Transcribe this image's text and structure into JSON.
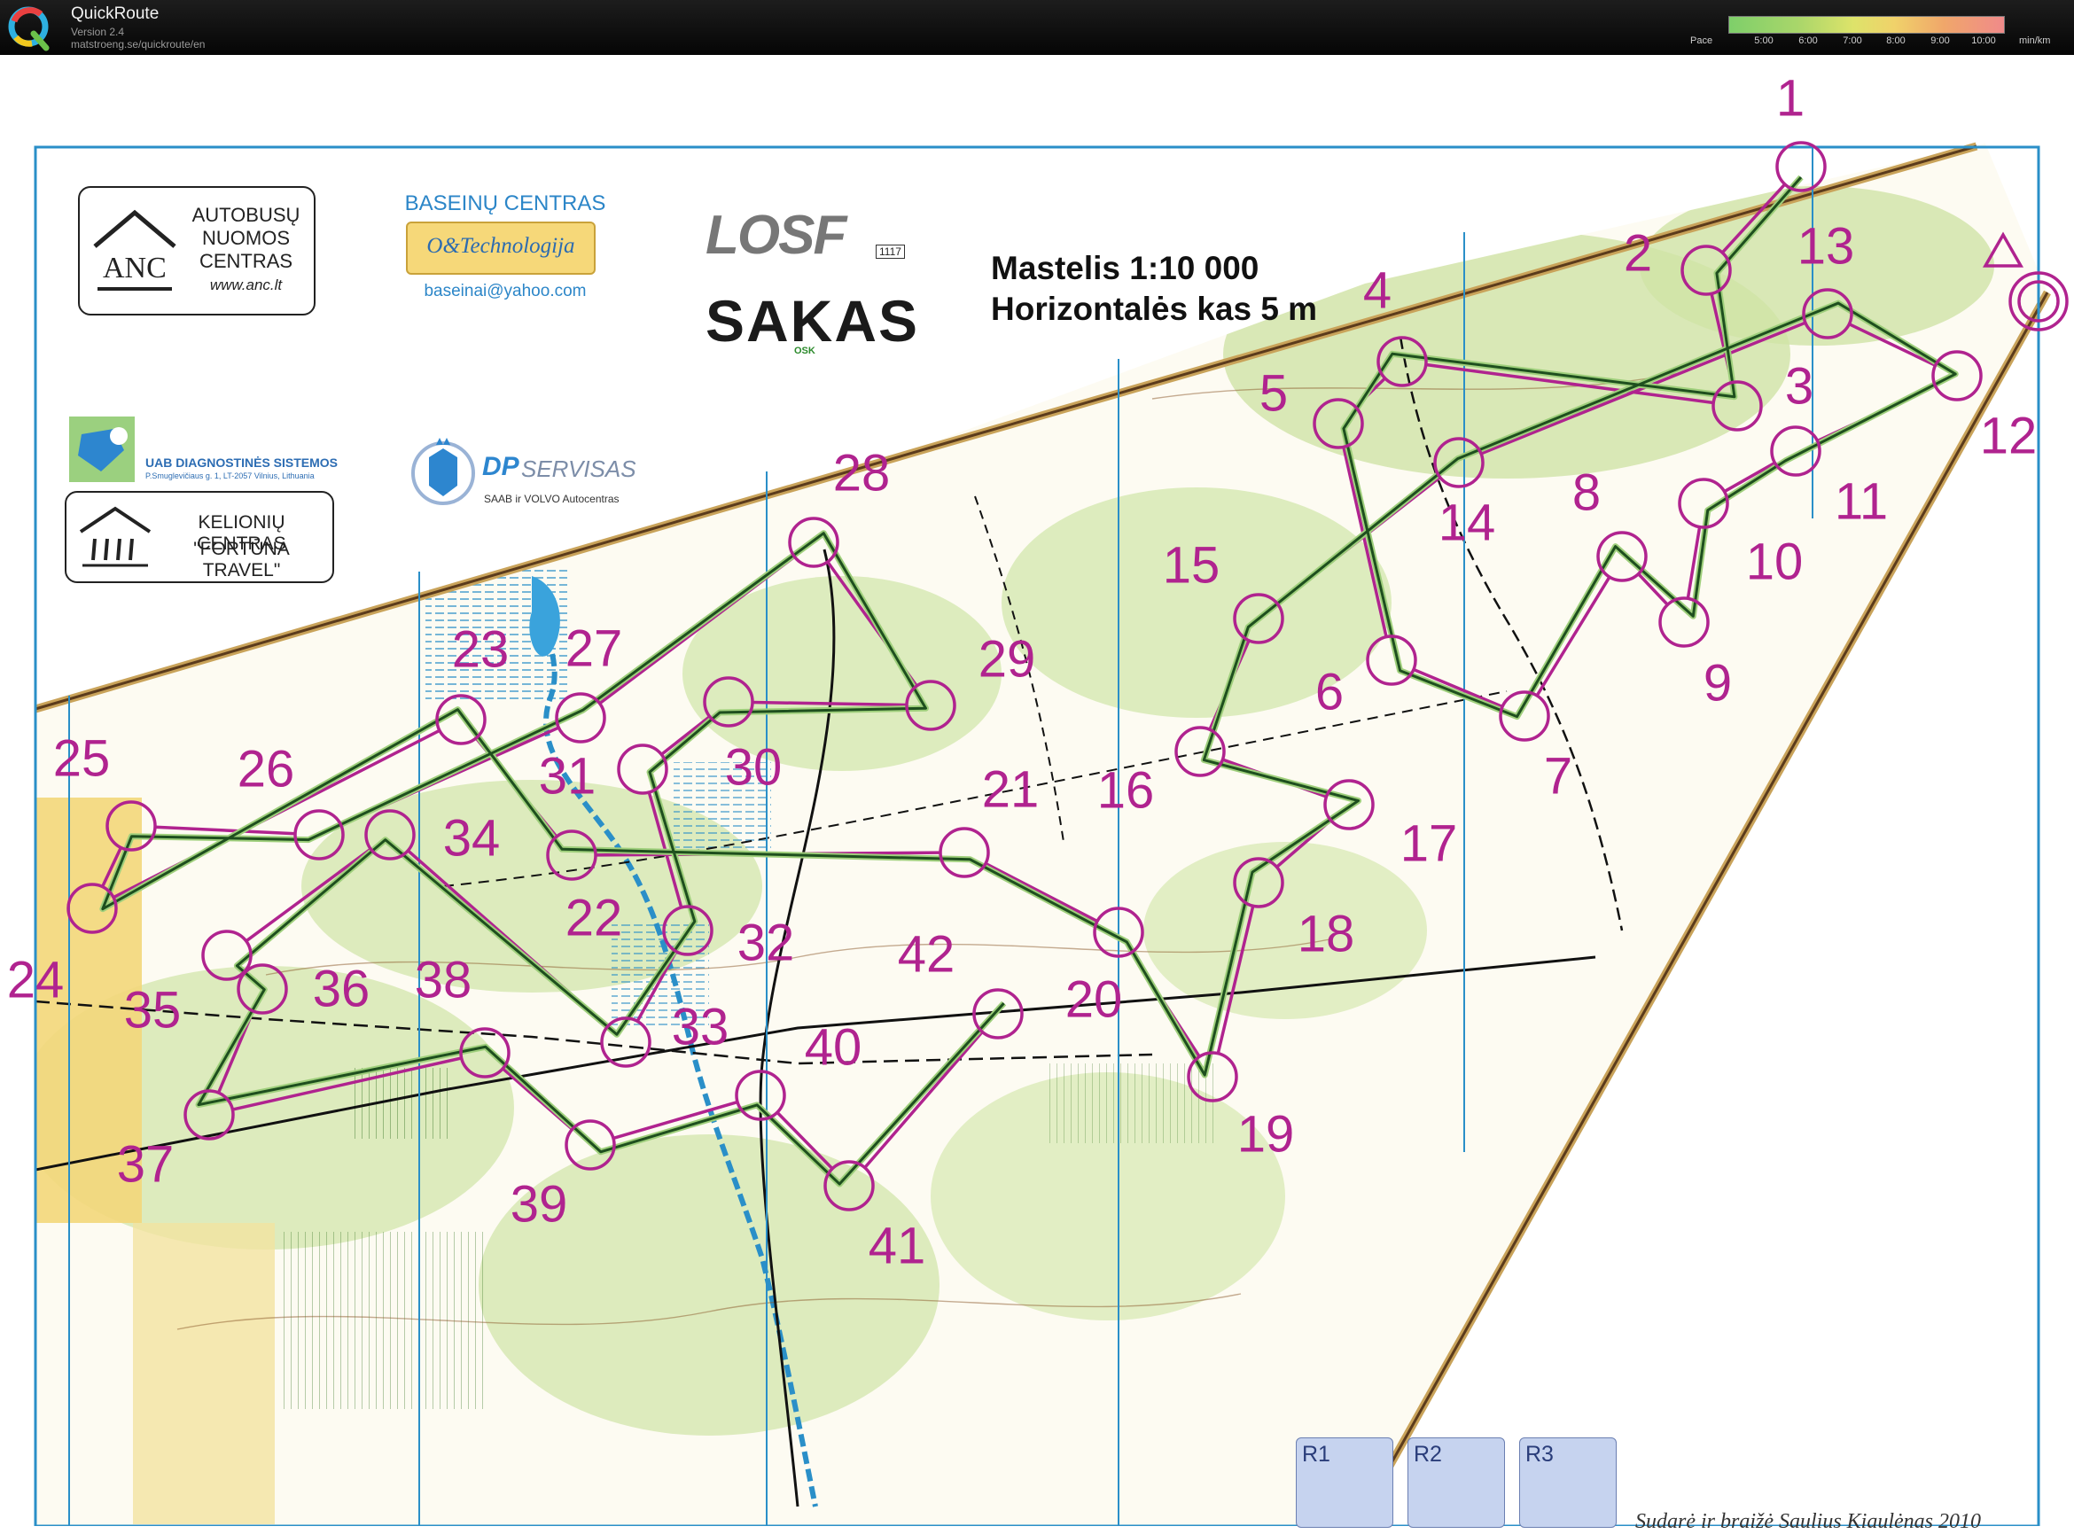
{
  "app": {
    "title": "QuickRoute",
    "version": "Version 2.4",
    "url": "matstroeng.se/quickroute/en"
  },
  "pace_legend": {
    "label": "Pace",
    "ticks": [
      "5:00",
      "6:00",
      "7:00",
      "8:00",
      "9:00",
      "10:00"
    ],
    "unit": "min/km"
  },
  "map": {
    "scale_line1": "Mastelis 1:10 000",
    "scale_line2": "Horizontalės kas 5 m",
    "credit": "Sudarė ir braižė Saulius Kiaulėnas 2010",
    "course_color": "#b0238f",
    "route_color": "#1e4f1e",
    "relay_boxes": [
      "R1",
      "R2",
      "R3"
    ],
    "controls": [
      "1",
      "2",
      "3",
      "4",
      "5",
      "6",
      "7",
      "8",
      "9",
      "10",
      "11",
      "12",
      "13",
      "14",
      "15",
      "16",
      "17",
      "18",
      "19",
      "20",
      "21",
      "22",
      "23",
      "24",
      "25",
      "26",
      "27",
      "28",
      "29",
      "30",
      "31",
      "32",
      "33",
      "34",
      "35",
      "36",
      "37",
      "38",
      "39",
      "40",
      "41",
      "42"
    ]
  },
  "sponsors": {
    "anc": {
      "line1": "AUTOBUSŲ",
      "line2": "NUOMOS",
      "line3": "CENTRAS",
      "url": "www.anc.lt",
      "mark": "ANC"
    },
    "baseinu": {
      "title": "BASEINŲ CENTRAS",
      "brand": "O&Technologija",
      "email": "baseinai@yahoo.com"
    },
    "losf": {
      "mark": "LOSF",
      "number": "1117"
    },
    "sakas": {
      "mark": "SAKAS",
      "sub": "OSK"
    },
    "uab": {
      "line1": "UAB DIAGNOSTINĖS SISTEMOS",
      "line2": "P.Smuglevičiaus g. 1, LT-2057 Vilnius, Lithuania"
    },
    "dp": {
      "mark": "DP",
      "word": "SERVISAS",
      "sub": "SAAB ir VOLVO Autocentras"
    },
    "fortuna": {
      "line1": "KELIONIŲ CENTRAS",
      "line2": "\"FORTŪNA TRAVEL\""
    }
  }
}
